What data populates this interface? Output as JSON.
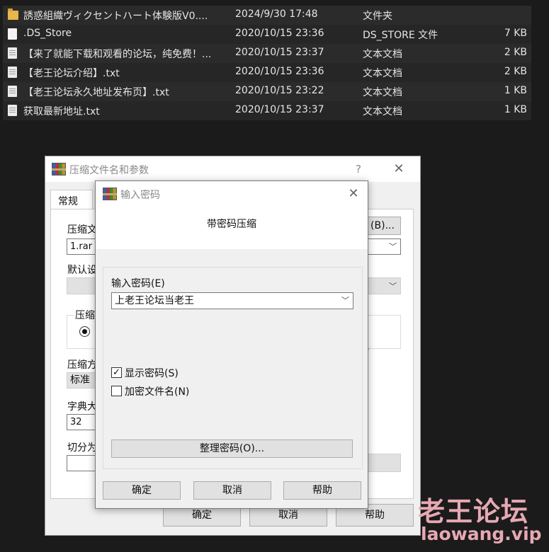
{
  "file_list": [
    {
      "icon": "folder-icon",
      "name": "誘惑組織ヴィクセントハート体験版V0....",
      "date": "2024/9/30 17:48",
      "type": "文件夹",
      "size": ""
    },
    {
      "icon": "file-icon",
      "name": ".DS_Store",
      "date": "2020/10/15 23:36",
      "type": "DS_STORE 文件",
      "size": "7 KB"
    },
    {
      "icon": "text-file-icon",
      "name": "【来了就能下载和观看的论坛，纯免费！...",
      "date": "2020/10/15 23:37",
      "type": "文本文档",
      "size": "2 KB"
    },
    {
      "icon": "text-file-icon",
      "name": "【老王论坛介绍】.txt",
      "date": "2020/10/15 23:36",
      "type": "文本文档",
      "size": "2 KB"
    },
    {
      "icon": "text-file-icon",
      "name": "【老王论坛永久地址发布页】.txt",
      "date": "2020/10/15 23:22",
      "type": "文本文档",
      "size": "1 KB"
    },
    {
      "icon": "text-file-icon",
      "name": "获取最新地址.txt",
      "date": "2020/10/15 23:37",
      "type": "文本文档",
      "size": "1 KB"
    }
  ],
  "archive_dialog": {
    "title": "压缩文件名和参数",
    "help": "?",
    "close": "✕",
    "tab_general": "常规",
    "archive_name_label": "压缩文",
    "archive_name_value": "1.rar",
    "browse_button": "(B)...",
    "default_profile_label": "默认设",
    "format_group_label": "压缩",
    "method_label": "压缩方",
    "method_value": "标准",
    "dict_label": "字典大",
    "dict_value": "32",
    "split_label": "切分为",
    "paren": ")",
    "ok": "确定",
    "cancel": "取消",
    "help_button": "帮助"
  },
  "password_dialog": {
    "title": "输入密码",
    "close": "✕",
    "heading": "带密码压缩",
    "password_label": "输入密码(E)",
    "password_value": "上老王论坛当老王",
    "show_password_label": "显示密码(S)",
    "show_password_checked": true,
    "encrypt_names_label": "加密文件名(N)",
    "encrypt_names_checked": false,
    "organize_button": "整理密码(O)...",
    "ok": "确定",
    "cancel": "取消",
    "help": "帮助"
  },
  "watermark": {
    "name": "老王论坛",
    "url": "laowang.vip"
  }
}
